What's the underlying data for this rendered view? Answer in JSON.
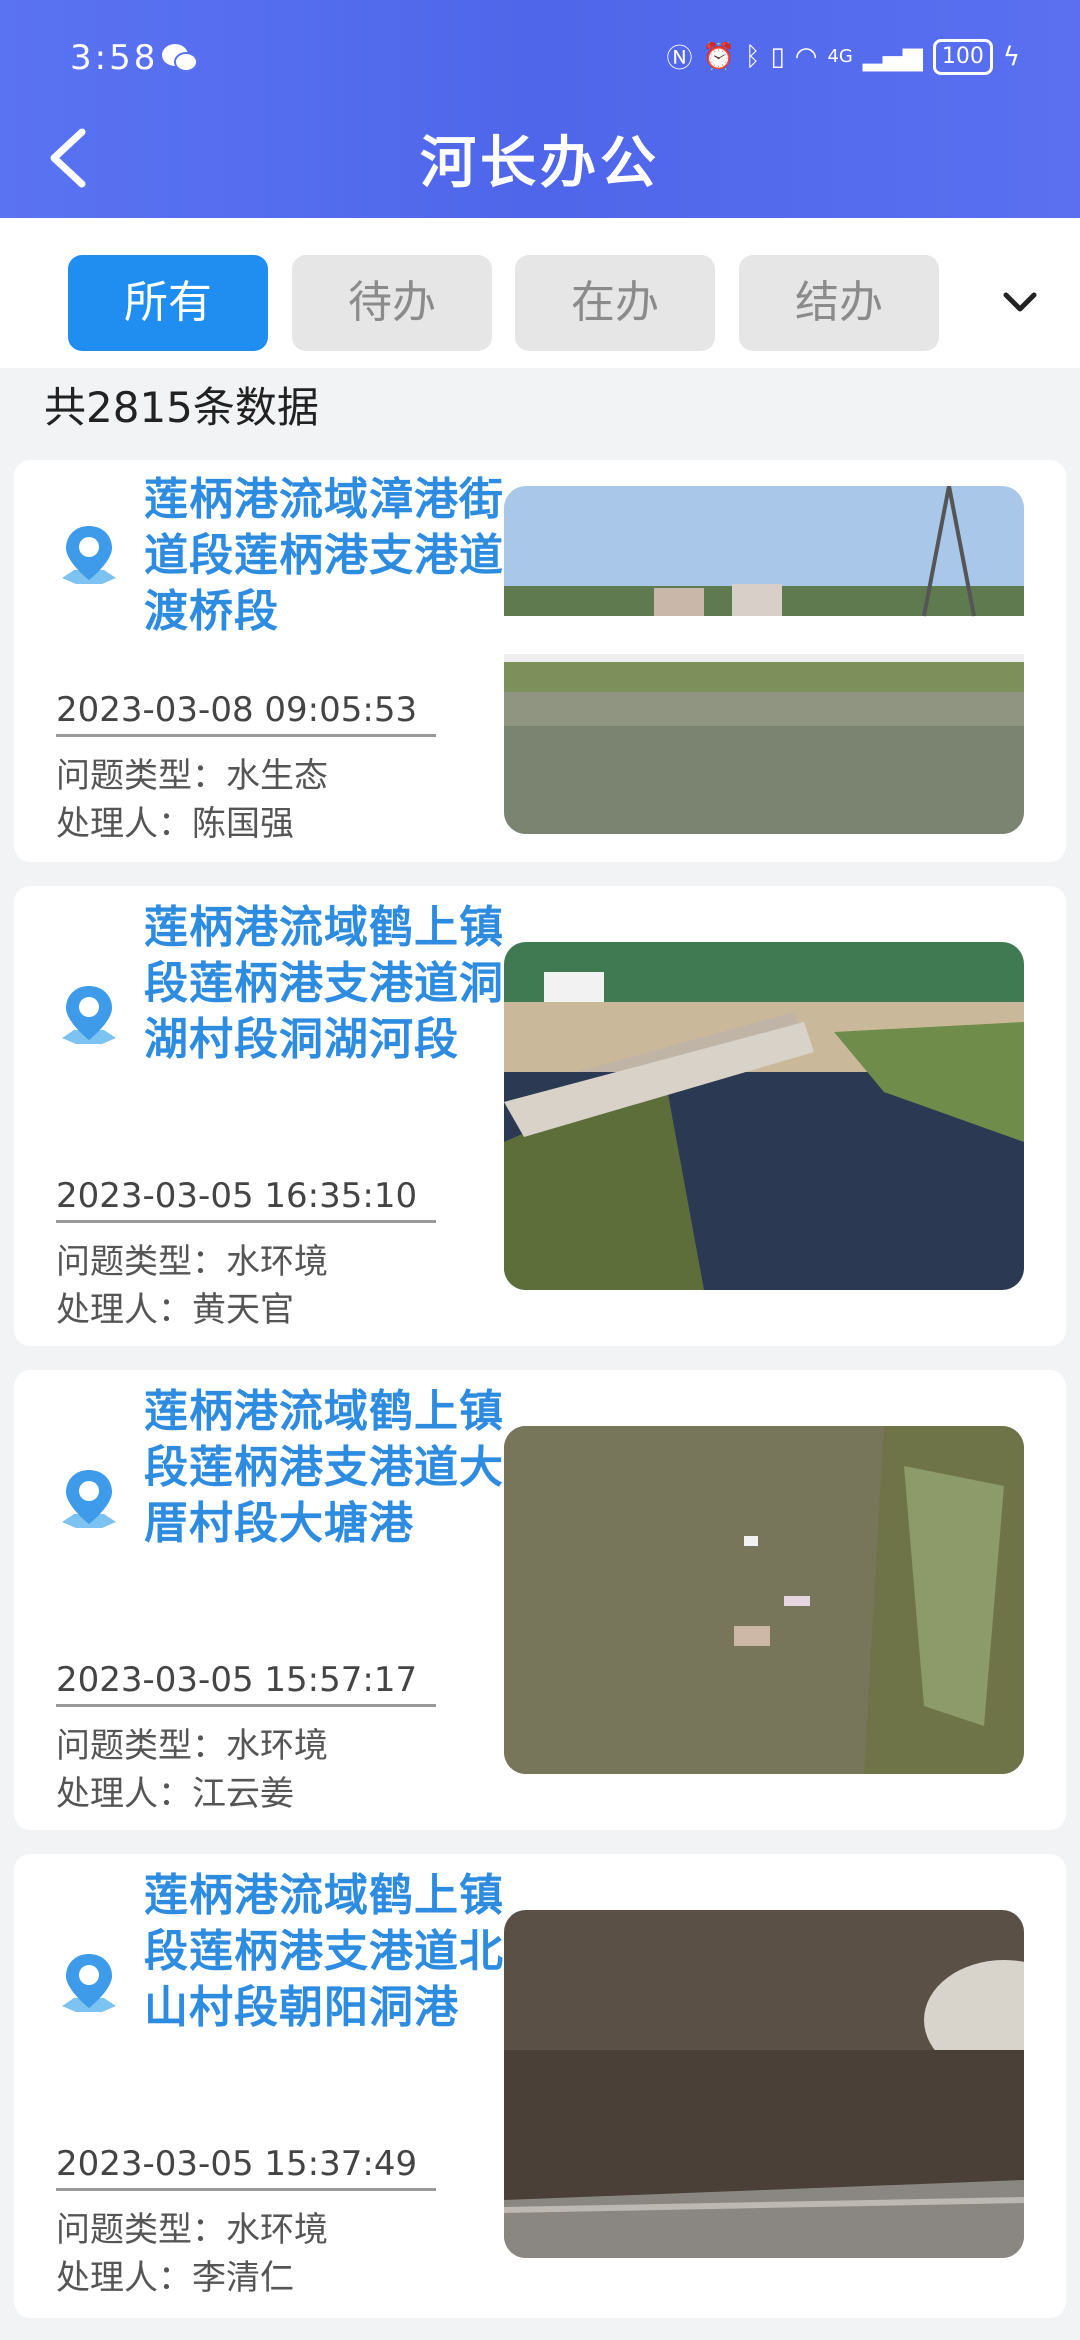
{
  "status": {
    "time": "3:58",
    "network": "4G",
    "battery": "100"
  },
  "header": {
    "title": "河长办公"
  },
  "tabs": [
    {
      "label": "所有"
    },
    {
      "label": "待办"
    },
    {
      "label": "在办"
    },
    {
      "label": "结办"
    }
  ],
  "count_text": "共2815条数据",
  "records": [
    {
      "title": "莲柄港流域漳港街道段莲柄港支港道渡桥段",
      "datetime": "2023-03-08 09:05:53",
      "type_label": "问题类型：",
      "type_value": "水生态",
      "handler_label": "处理人：",
      "handler_value": "陈国强"
    },
    {
      "title": "莲柄港流域鹤上镇段莲柄港支港道洞湖村段洞湖河段",
      "datetime": "2023-03-05 16:35:10",
      "type_label": "问题类型：",
      "type_value": "水环境",
      "handler_label": "处理人：",
      "handler_value": "黄天官"
    },
    {
      "title": "莲柄港流域鹤上镇段莲柄港支港道大厝村段大塘港",
      "datetime": "2023-03-05 15:57:17",
      "type_label": "问题类型：",
      "type_value": "水环境",
      "handler_label": "处理人：",
      "handler_value": "江云姜"
    },
    {
      "title": "莲柄港流域鹤上镇段莲柄港支港道北山村段朝阳洞港",
      "datetime": "2023-03-05 15:37:49",
      "type_label": "问题类型：",
      "type_value": "水环境",
      "handler_label": "处理人：",
      "handler_value": "李清仁"
    }
  ]
}
